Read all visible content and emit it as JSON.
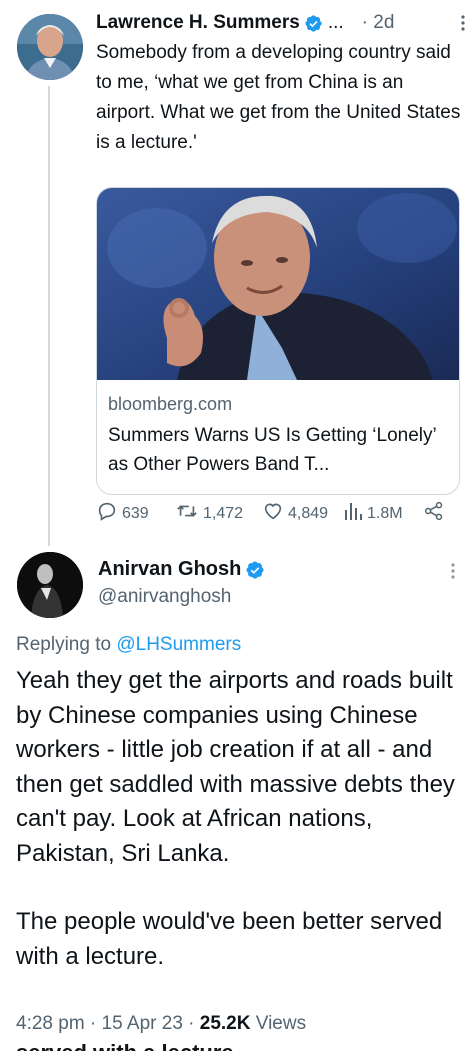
{
  "tweet1": {
    "author_name": "Lawrence H. Summers",
    "truncation": "...",
    "time": "· 2d",
    "text": "Somebody from a developing country said to me, ‘what we get from China is an airport. What we get from the United States is a lecture.'",
    "card": {
      "domain": "bloomberg.com",
      "title": "Summers Warns US Is Getting ‘Lonely’ as Other Powers Band T..."
    },
    "actions": {
      "replies": "639",
      "retweets": "1,472",
      "likes": "4,849",
      "views": "1.8M"
    }
  },
  "tweet2": {
    "author_name": "Anirvan Ghosh",
    "handle": "@anirvanghosh",
    "replying_prefix": "Replying to ",
    "replying_to": "@LHSummers",
    "text_p1": "Yeah they get the airports and roads built by Chinese companies using Chinese workers - little job creation if at all - and then get saddled with massive debts they can't pay. Look at African nations, Pakistan, Sri Lanka.",
    "text_p2": "The people would've been better served with a lecture.",
    "time": "4:28 pm · 15 Apr 23 · ",
    "views_count": "25.2K",
    "views_label": " Views",
    "clipped_text": "served with a lecture"
  },
  "colors": {
    "accent": "#1d9bf0",
    "secondary_text": "#536471",
    "primary_text": "#0f1419",
    "thread_line": "#cfd9de"
  },
  "icons": [
    "verified-badge-icon",
    "more-icon",
    "reply-icon",
    "retweet-icon",
    "like-icon",
    "views-icon",
    "share-icon"
  ]
}
